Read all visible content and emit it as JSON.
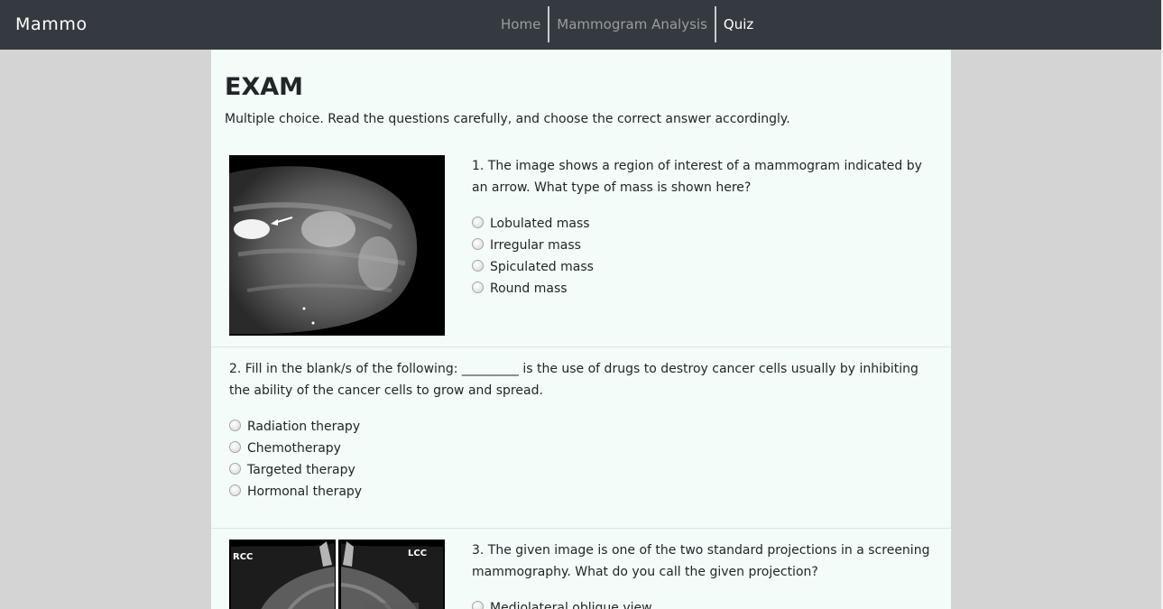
{
  "navbar": {
    "brand": "Mammo",
    "links": [
      {
        "label": "Home",
        "active": false
      },
      {
        "label": "Mammogram Analysis",
        "active": false
      },
      {
        "label": "Quiz",
        "active": true
      }
    ]
  },
  "exam": {
    "title": "EXAM",
    "instructions": "Multiple choice. Read the questions carefully, and choose the correct answer accordingly."
  },
  "questions": [
    {
      "text": "1. The image shows a region of interest of a mammogram indicated by an arrow. What type of mass is shown here?",
      "options": [
        "Lobulated mass",
        "Irregular mass",
        "Spiculated mass",
        "Round mass"
      ]
    },
    {
      "text": "2. Fill in the blank/s of the following: _________ is the use of drugs to destroy cancer cells usually by inhibiting the ability of the cancer cells to grow and spread.",
      "options": [
        "Radiation therapy",
        "Chemotherapy",
        "Targeted therapy",
        "Hormonal therapy"
      ]
    },
    {
      "text": "3. The given image is one of the two standard projections in a screening mammography. What do you call the given projection?",
      "image_labels": [
        "RCC",
        "LCC"
      ],
      "options": [
        "Mediolateral oblique view"
      ]
    }
  ]
}
